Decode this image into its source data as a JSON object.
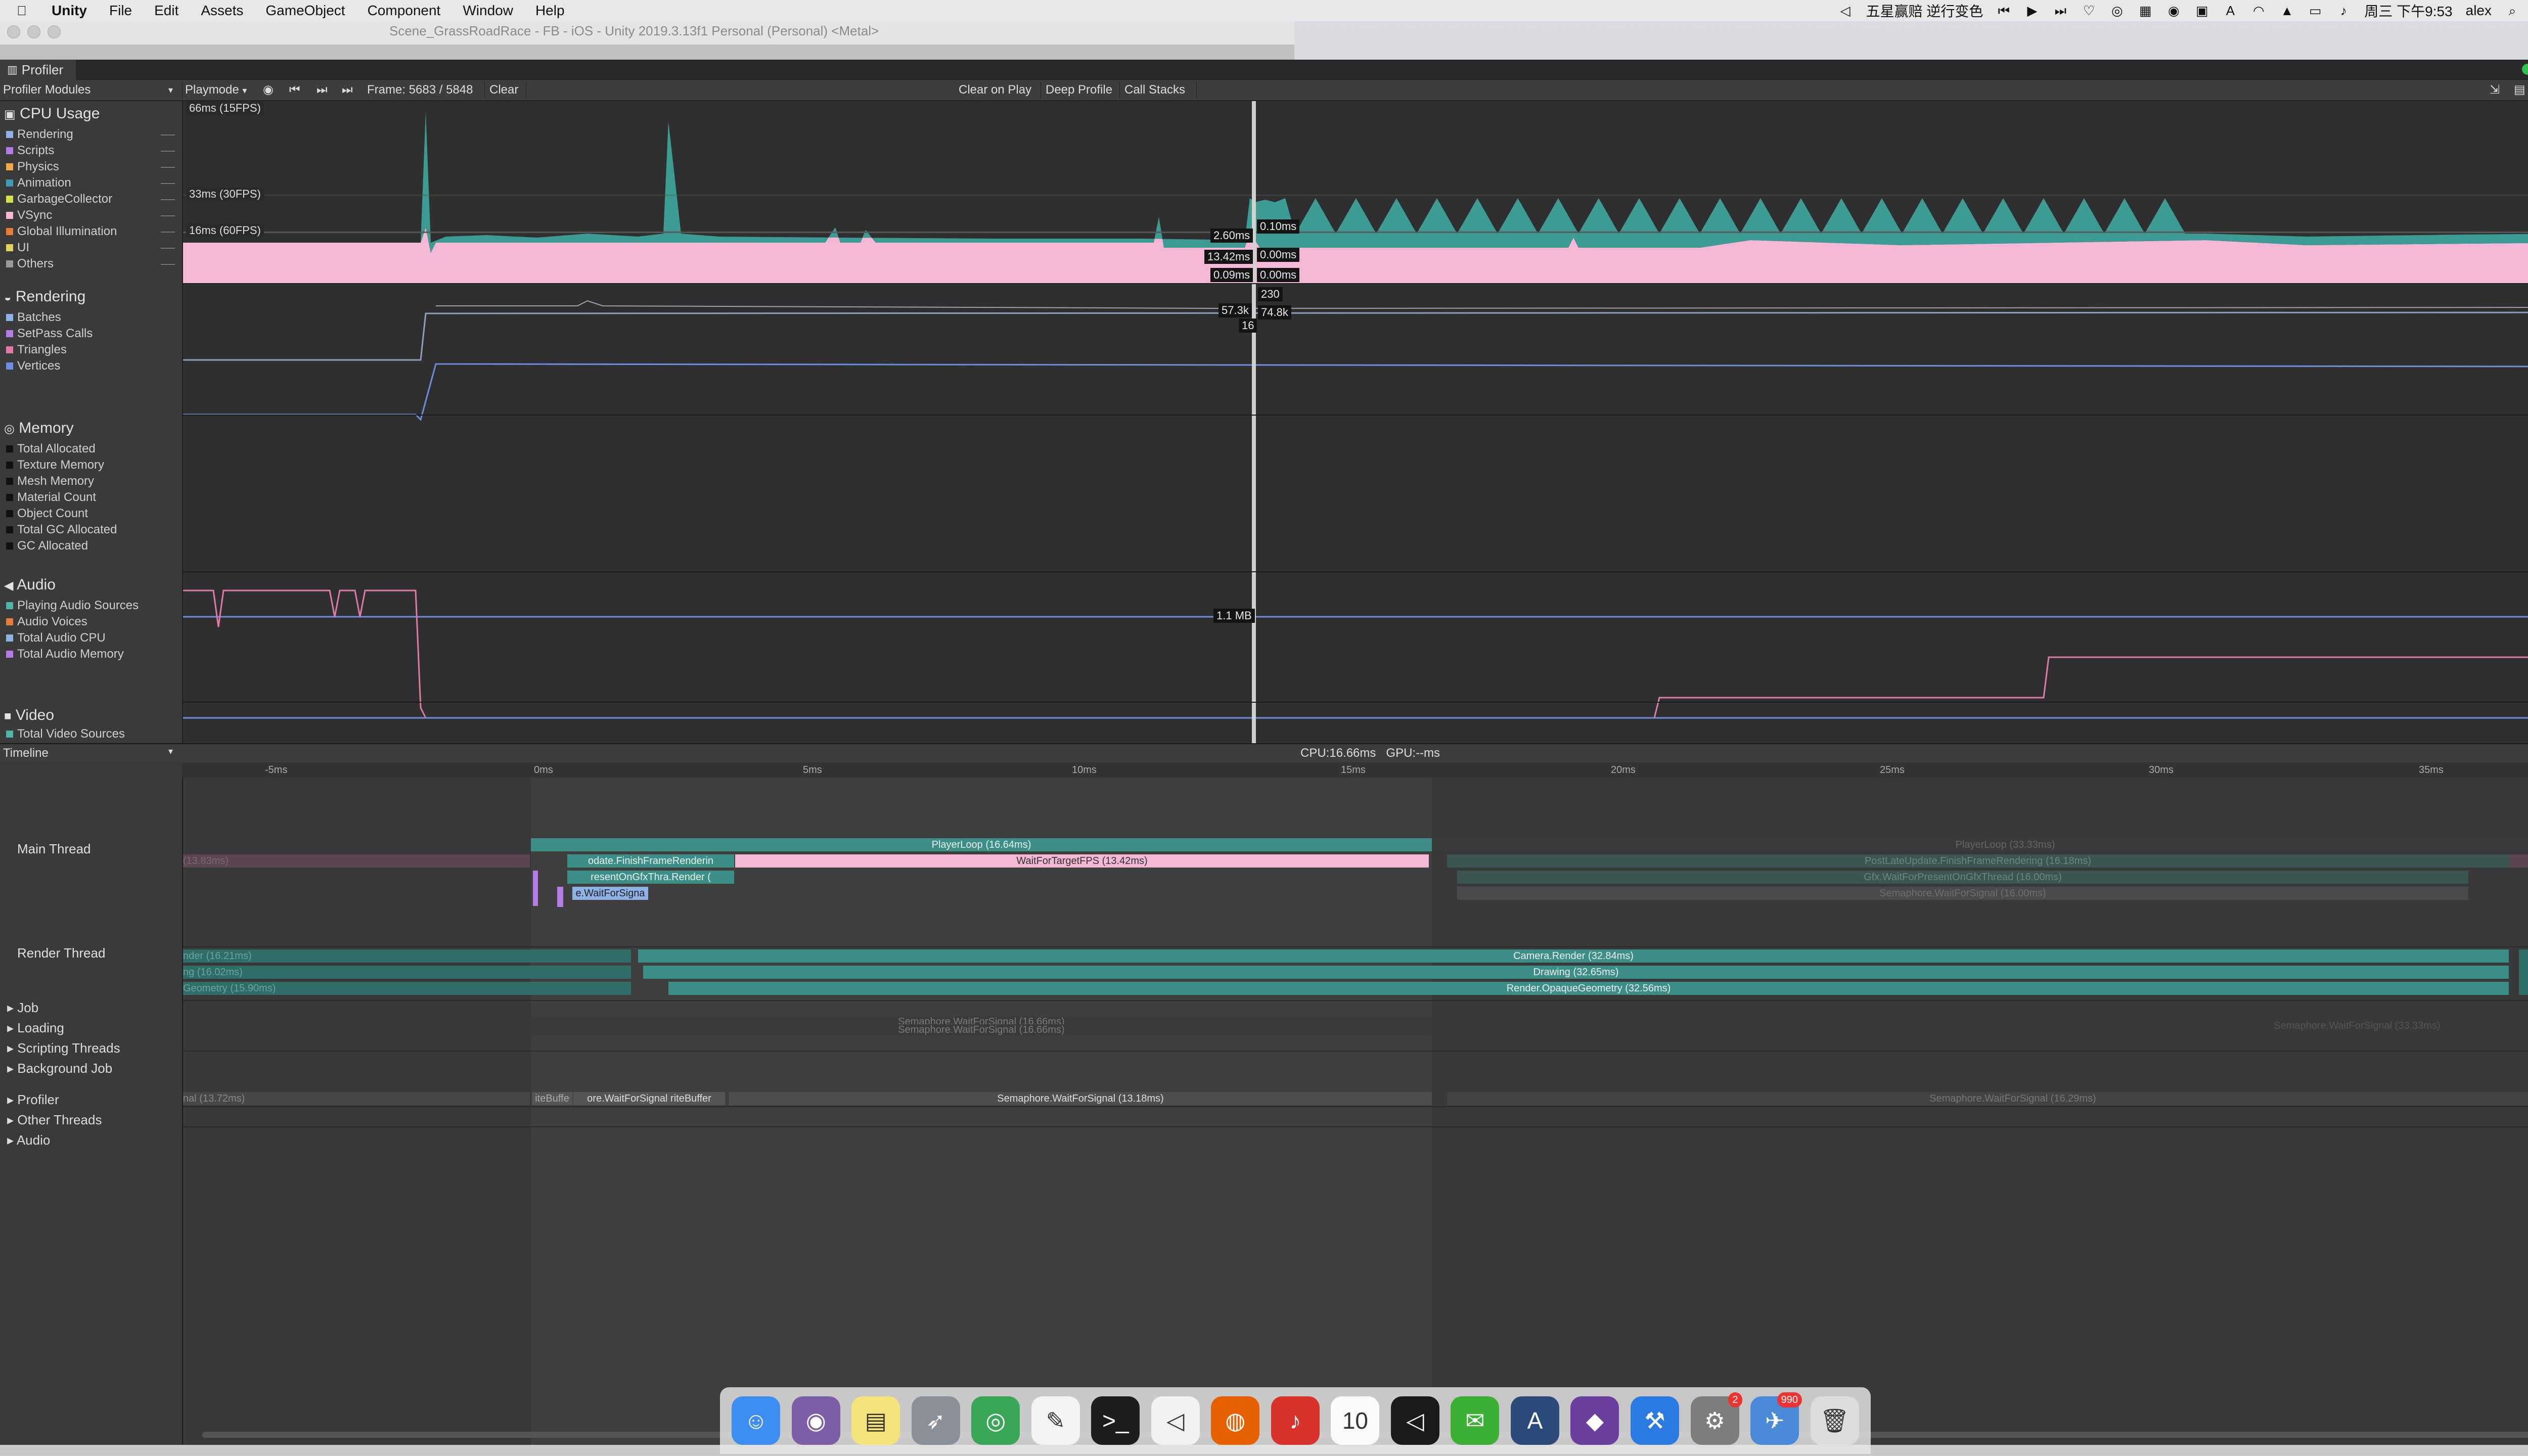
{
  "menubar": {
    "apple": "",
    "items": [
      "Unity",
      "File",
      "Edit",
      "Assets",
      "GameObject",
      "Component",
      "Window",
      "Help"
    ],
    "right": {
      "song": "五星赢赔 逆行变色",
      "clock": "周三 下午9:53",
      "user": "alex"
    }
  },
  "bg_window": {
    "title": "Scene_GrassRoadRace - FB - iOS - Unity 2019.3.13f1 Personal (Personal) <Metal>"
  },
  "profiler": {
    "tab": "Profiler",
    "toolbar": {
      "modules": "Profiler Modules",
      "playmode": "Playmode",
      "frame": "Frame: 5683 / 5848",
      "clear": "Clear",
      "clear_on_play": "Clear on Play",
      "deep_profile": "Deep Profile",
      "call_stacks": "Call Stacks"
    },
    "modules": [
      {
        "name": "CPU Usage",
        "items": [
          {
            "label": "Rendering",
            "color": "#8db3e6"
          },
          {
            "label": "Scripts",
            "color": "#b77be8"
          },
          {
            "label": "Physics",
            "color": "#f1a94b"
          },
          {
            "label": "Animation",
            "color": "#3f9ab5"
          },
          {
            "label": "GarbageCollector",
            "color": "#d6e04a"
          },
          {
            "label": "VSync",
            "color": "#f4b7d6"
          },
          {
            "label": "Global Illumination",
            "color": "#e87d3a"
          },
          {
            "label": "UI",
            "color": "#e0d25b"
          },
          {
            "label": "Others",
            "color": "#9a9a9a"
          }
        ]
      },
      {
        "name": "Rendering",
        "items": [
          {
            "label": "Batches",
            "color": "#8db3e6"
          },
          {
            "label": "SetPass Calls",
            "color": "#b77be8"
          },
          {
            "label": "Triangles",
            "color": "#e07aa8"
          },
          {
            "label": "Vertices",
            "color": "#6a8ee0"
          }
        ]
      },
      {
        "name": "Memory",
        "items": [
          {
            "label": "Total Allocated",
            "color": "#111111"
          },
          {
            "label": "Texture Memory",
            "color": "#111111"
          },
          {
            "label": "Mesh Memory",
            "color": "#111111"
          },
          {
            "label": "Material Count",
            "color": "#111111"
          },
          {
            "label": "Object Count",
            "color": "#111111"
          },
          {
            "label": "Total GC Allocated",
            "color": "#111111"
          },
          {
            "label": "GC Allocated",
            "color": "#111111"
          }
        ]
      },
      {
        "name": "Audio",
        "items": [
          {
            "label": "Playing Audio Sources",
            "color": "#4db6a8"
          },
          {
            "label": "Audio Voices",
            "color": "#e87d3a"
          },
          {
            "label": "Total Audio CPU",
            "color": "#8db3e6"
          },
          {
            "label": "Total Audio Memory",
            "color": "#b77be8"
          }
        ]
      },
      {
        "name": "Video",
        "items": [
          {
            "label": "Total Video Sources",
            "color": "#4db6a8"
          }
        ]
      }
    ],
    "cpu_graph": {
      "fps_labels": [
        "66ms (15FPS)",
        "33ms (30FPS)",
        "16ms (60FPS)"
      ],
      "tags": [
        "2.60ms",
        "0.10ms",
        "13.42ms",
        "0.00ms",
        "0.09ms",
        "0.00ms"
      ]
    },
    "rendering_graph": {
      "tags": [
        "230",
        "57.3k",
        "74.8k",
        "16"
      ]
    },
    "memory_graph": {
      "tags": [
        "1.1 MB"
      ]
    },
    "timeline": {
      "mode": "Timeline",
      "cpu_gpu": "CPU:16.66ms   GPU:--ms",
      "ticks": [
        "-5ms",
        "0ms",
        "5ms",
        "10ms",
        "15ms",
        "20ms",
        "25ms",
        "30ms",
        "35ms"
      ],
      "threads": [
        "Main Thread",
        "Render Thread"
      ],
      "groups": [
        "Job",
        "Loading",
        "Scripting Threads",
        "Background Job",
        "Profiler",
        "Other Threads",
        "Audio"
      ],
      "main_bars": {
        "playerloop": "PlayerLoop (16.64ms)",
        "playerloop_next": "PlayerLoop (33.33ms)",
        "finish_frame": "odate.FinishFrameRenderin",
        "wait_fps": "WaitForTargetFPS (13.42ms)",
        "present": "resentOnGfxThra.Render (",
        "waitsig": "e.WaitForSigna",
        "postlate": "PostLateUpdate.FinishFrameRendering (16.18ms)",
        "gfx_wait": "Gfx.WaitForPresentOnGfxThread (16.00ms)",
        "sema_wait": "Semaphore.WaitForSignal (16.00ms)",
        "left_dim": "(13.83ms)"
      },
      "render_bars": {
        "camera": "Camera.Render (32.84ms)",
        "drawing": "Drawing (32.65ms)",
        "opaque": "Render.OpaqueGeometry (32.56ms)",
        "left1": "nder (16.21ms)",
        "left2": "ng (16.02ms)",
        "left3": "Geometry (15.90ms)"
      },
      "loading_bars": {
        "sema1": "Semaphore.WaitForSignal (16.66ms)",
        "sema2": "Semaphore.WaitForSignal (16.66ms)",
        "sema_r": "Semaphore.WaitForSignal (33.33ms)"
      },
      "profiler_bars": {
        "left": "nal (13.72ms)",
        "a": "iteBuffe",
        "b": "ore.WaitForSignal riteBuffer",
        "mid": "Semaphore.WaitForSignal (13.18ms)",
        "right": "Semaphore.WaitForSignal (16.29ms)"
      }
    }
  },
  "dock": {
    "icons": [
      {
        "name": "finder",
        "color": "#3d8ef0",
        "glyph": "☺"
      },
      {
        "name": "github",
        "color": "#7b5ea7",
        "glyph": "◉"
      },
      {
        "name": "notes",
        "color": "#f4e27a",
        "glyph": "▤"
      },
      {
        "name": "launchpad",
        "color": "#8a8f98",
        "glyph": "➶"
      },
      {
        "name": "chrome",
        "color": "#3aa757",
        "glyph": "◎"
      },
      {
        "name": "textedit",
        "color": "#f3f3f3",
        "glyph": "✎"
      },
      {
        "name": "terminal",
        "color": "#1d1d1d",
        "glyph": ">_"
      },
      {
        "name": "unity-hub",
        "color": "#f2f2f2",
        "glyph": "◁"
      },
      {
        "name": "firefox",
        "color": "#e66000",
        "glyph": "◍"
      },
      {
        "name": "netease-music",
        "color": "#d8322b",
        "glyph": "♪"
      },
      {
        "name": "calendar",
        "color": "#fafafa",
        "glyph": "10"
      },
      {
        "name": "unity",
        "color": "#1a1a1a",
        "glyph": "◁"
      },
      {
        "name": "wechat",
        "color": "#3cb034",
        "glyph": "✉"
      },
      {
        "name": "instruments",
        "color": "#2b4a7a",
        "glyph": "A"
      },
      {
        "name": "visual-studio",
        "color": "#6b3fa0",
        "glyph": "◆"
      },
      {
        "name": "xcode",
        "color": "#2a7ae2",
        "glyph": "⚒"
      },
      {
        "name": "system-preferences",
        "color": "#7d7d7d",
        "glyph": "⚙",
        "badge": "2"
      },
      {
        "name": "mail-app",
        "color": "#4a8ad8",
        "glyph": "✈",
        "badge": "990"
      },
      {
        "name": "trash",
        "color": "#dcdcdc",
        "glyph": "🗑"
      }
    ]
  }
}
